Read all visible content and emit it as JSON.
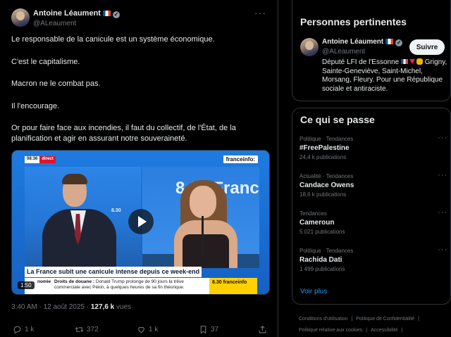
{
  "tweet": {
    "author_name": "Antoine Léaument",
    "author_handle": "@ALeaument",
    "paragraphs": [
      "Le responsable de la canicule est un système économique.",
      "C'est le capitalisme.",
      "Macron ne le combat pas.",
      "Il l'encourage.",
      "Or pour faire face aux incendies, il faut du collectif, de l'État, de la planification et agir en assurant notre souveraineté."
    ],
    "video": {
      "time_chip": "08:36",
      "direct_chip": "direct",
      "channel": "franceinfo:",
      "background_text": "8.30 France",
      "background_time": "8.30",
      "headline": "La France subit une canicule intense depuis ce week-end",
      "ticker_label": "nomie",
      "ticker_title": "Droits de douane :",
      "ticker_text": "Donald Trump prolonge de 90 jours la trêve commerciale avec Pékin, à quelques heures de sa fin théorique.",
      "ticker_right": "8.30 franceinfo",
      "duration": "1:50"
    },
    "time": "3:40 AM",
    "date": "12 août 2025",
    "views_count": "127,6 k",
    "views_label": "vues",
    "actions": {
      "replies": "1 k",
      "retweets": "372",
      "likes": "1 k",
      "bookmarks": "37"
    }
  },
  "relevant_people": {
    "title": "Personnes pertinentes",
    "name": "Antoine Léaument",
    "handle": "@ALeaument",
    "follow_label": "Suivre",
    "bio_prefix": "Député LFI de l'Essonne",
    "bio_rest": "Grigny, Sainte-Geneviève, Saint-Michel, Morsang, Fleury. Pour une République sociale et antiraciste."
  },
  "whats_happening": {
    "title": "Ce qui se passe",
    "trends": [
      {
        "category": "Politique · Tendances",
        "name": "#FreePalestine",
        "count": "24,4 k publications"
      },
      {
        "category": "Actualité · Tendances",
        "name": "Candace Owens",
        "count": "18,6 k publications"
      },
      {
        "category": "Tendances",
        "name": "Cameroun",
        "count": "5 021 publications"
      },
      {
        "category": "Politique · Tendances",
        "name": "Rachida Dati",
        "count": "1 499 publications"
      }
    ],
    "see_more": "Voir plus"
  },
  "footer": {
    "links": [
      "Conditions d'utilisation",
      "Politique de Confidentialité",
      "Politique relative aux cookies",
      "Accessibilité"
    ]
  }
}
